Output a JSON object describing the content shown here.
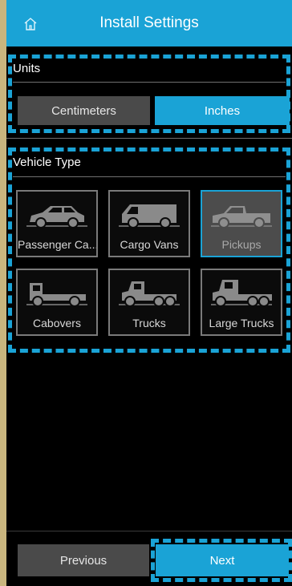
{
  "header": {
    "title": "Install Settings",
    "home_icon": "home-icon"
  },
  "units": {
    "label": "Units",
    "options": [
      "Centimeters",
      "Inches"
    ],
    "selected": "Inches"
  },
  "vehicle_type": {
    "label": "Vehicle Type",
    "options": [
      {
        "label": "Passenger Ca...",
        "icon": "passenger-car-icon"
      },
      {
        "label": "Cargo Vans",
        "icon": "cargo-van-icon"
      },
      {
        "label": "Pickups",
        "icon": "pickup-truck-icon",
        "selected": true
      },
      {
        "label": "Cabovers",
        "icon": "cabover-truck-icon"
      },
      {
        "label": "Trucks",
        "icon": "truck-icon"
      },
      {
        "label": "Large Trucks",
        "icon": "large-truck-icon"
      }
    ]
  },
  "footer": {
    "previous_label": "Previous",
    "next_label": "Next"
  },
  "colors": {
    "accent": "#1aa3d6",
    "button_gray": "#4a4a4a",
    "background": "#000000",
    "tile_border": "#7a7a7a"
  }
}
